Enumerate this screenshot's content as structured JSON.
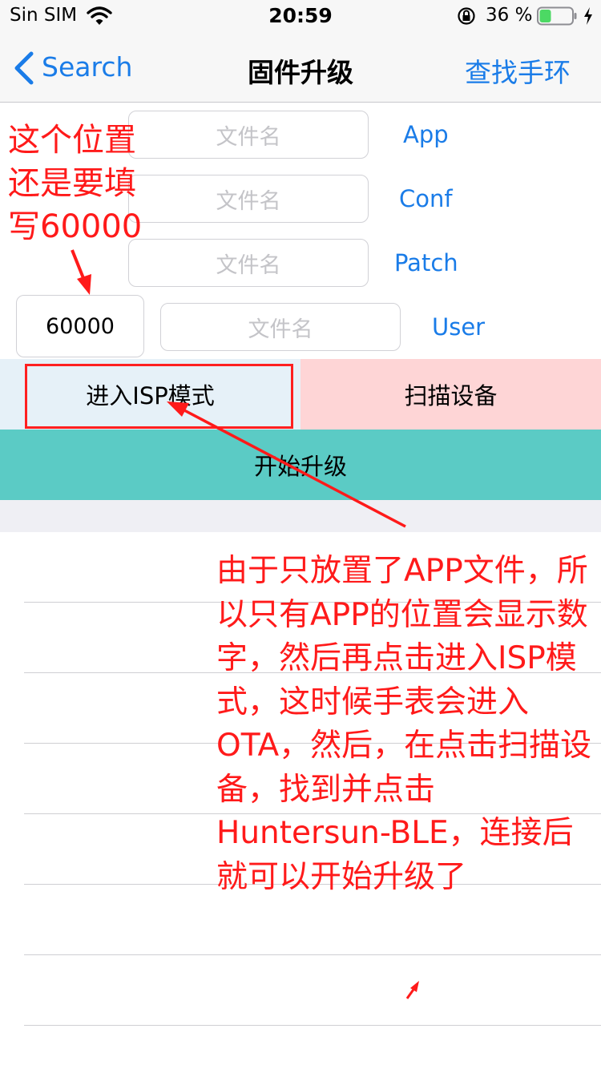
{
  "status_bar": {
    "carrier": "Sin SIM",
    "time": "20:59",
    "battery_percent": "36 %",
    "battery_level": 0.36,
    "icons": [
      "wifi-icon",
      "orientation-lock-icon",
      "battery-icon",
      "charging-icon"
    ]
  },
  "nav": {
    "back_label": "Search",
    "title": "固件升级",
    "right_label": "查找手环"
  },
  "form": {
    "rows": [
      {
        "placeholder": "文件名",
        "label": "App"
      },
      {
        "placeholder": "文件名",
        "label": "Conf"
      },
      {
        "placeholder": "文件名",
        "label": "Patch"
      },
      {
        "placeholder": "文件名",
        "label": "User"
      }
    ],
    "number_value": "60000"
  },
  "buttons": {
    "isp": "进入ISP模式",
    "scan": "扫描设备",
    "upgrade": "开始升级"
  },
  "annotations": {
    "top_note": "这个位置还是要填写60000",
    "main_note": "由于只放置了APP文件，所以只有APP的位置会显示数字，然后再点击进入ISP模式，这时候手表会进入OTA，然后，在点击扫描设备，找到并点击Huntersun-BLE，连接后就可以开始升级了"
  },
  "colors": {
    "accent": "#1a7ce8",
    "isp_bg": "#e6f1f8",
    "scan_bg": "#fed5d6",
    "upgrade_bg": "#5bcbc5",
    "annotation": "#ff1a1a"
  }
}
